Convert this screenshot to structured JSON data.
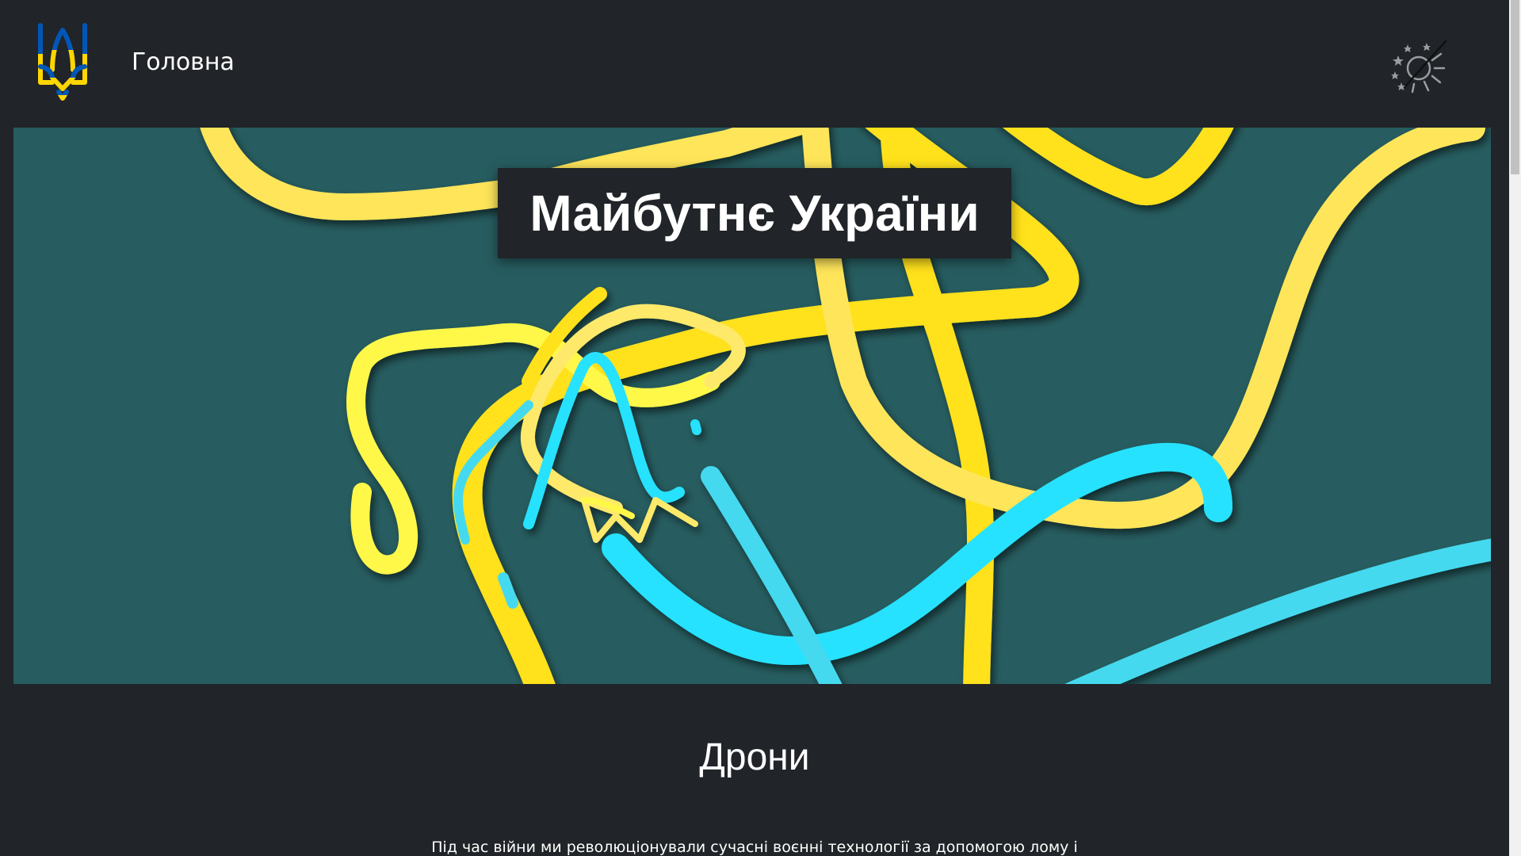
{
  "nav": {
    "home_label": "Головна"
  },
  "hero": {
    "title": "Майбутнє України"
  },
  "section": {
    "title": "Дрони",
    "text": "Під час війни ми революціонували сучасні воєнні технології за допомогою лому і"
  },
  "colors": {
    "background": "#212428",
    "hero_background": "#275d60",
    "yellow": "#ffe11f",
    "cyan": "#25e2ff",
    "blue": "#0057b7"
  },
  "icons": {
    "logo": "ukraine-trident-icon",
    "theme_toggle": "theme-toggle-icon"
  }
}
